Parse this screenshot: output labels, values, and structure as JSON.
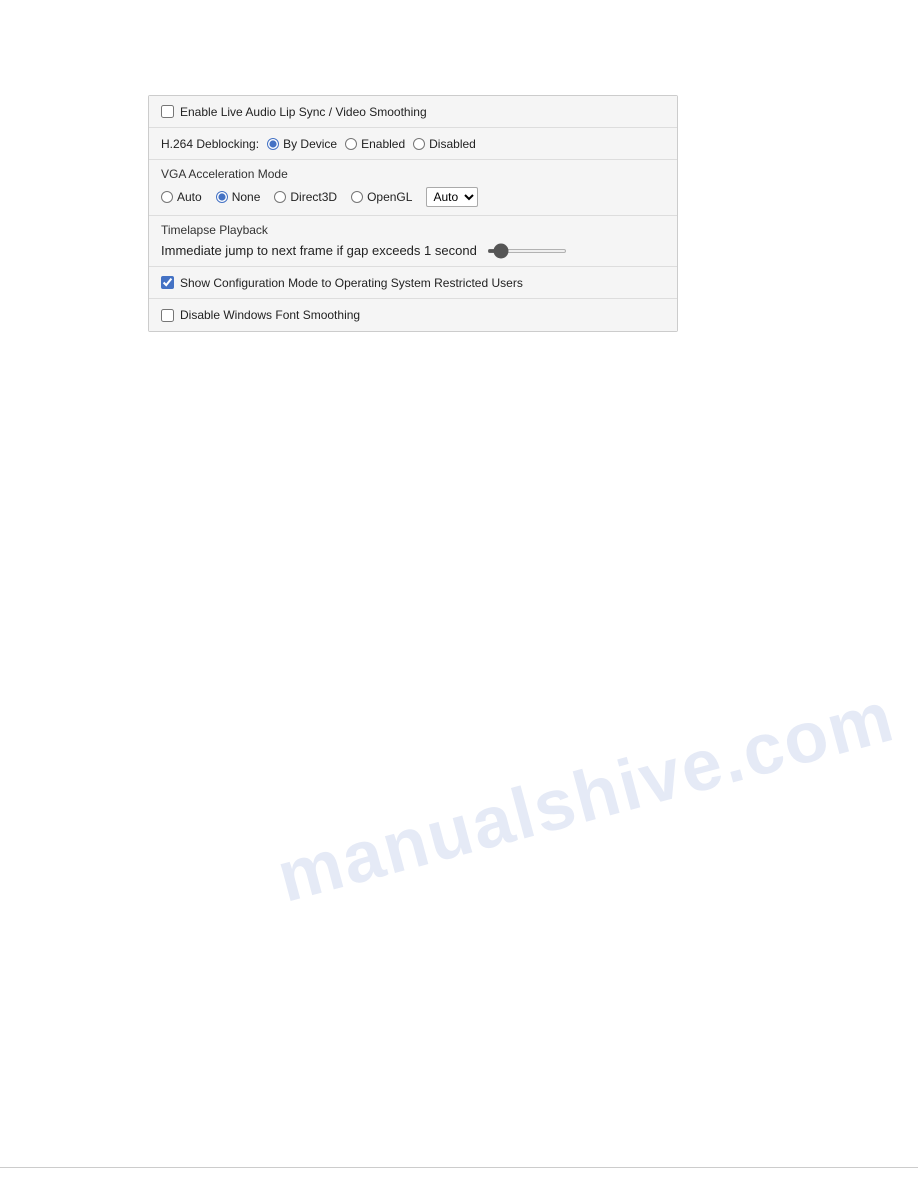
{
  "panel": {
    "sections": {
      "live_audio": {
        "checkbox_label": "Enable Live Audio Lip Sync / Video Smoothing",
        "checked": false
      },
      "h264_deblocking": {
        "label": "H.264 Deblocking:",
        "options": [
          "By Device",
          "Enabled",
          "Disabled"
        ],
        "selected": "By Device"
      },
      "vga_acceleration": {
        "label": "VGA Acceleration Mode",
        "options": [
          "Auto",
          "None",
          "Direct3D",
          "OpenGL"
        ],
        "selected": "None",
        "dropdown": {
          "options": [
            "Auto"
          ],
          "selected": "Auto"
        }
      },
      "timelapse": {
        "label": "Timelapse Playback",
        "slider_text": "Immediate jump to next frame if gap exceeds",
        "slider_value": "1",
        "slider_unit": "second",
        "slider_min": 0,
        "slider_max": 10,
        "slider_current": 1
      },
      "show_config": {
        "checkbox_label": "Show Configuration Mode to Operating System Restricted Users",
        "checked": true
      },
      "disable_font": {
        "checkbox_label": "Disable Windows Font Smoothing",
        "checked": false
      }
    }
  },
  "watermark": {
    "text": "manualshive.com"
  }
}
